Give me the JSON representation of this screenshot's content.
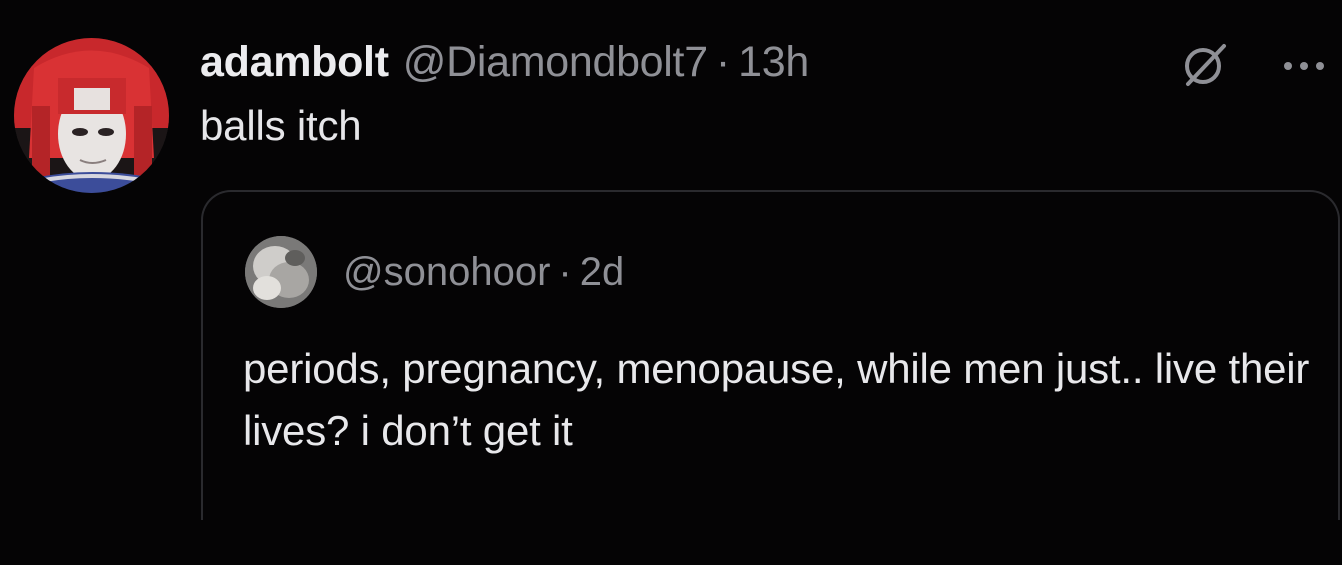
{
  "tweet": {
    "author": {
      "display_name": "adambolt",
      "handle": "@Diamondbolt7",
      "avatar_icon": "avatar-icon"
    },
    "separator": "·",
    "time": "13h",
    "text": "balls itch",
    "actions": {
      "grok_icon": "grok-icon",
      "more_icon": "more-icon"
    }
  },
  "quote": {
    "handle": "@sonohoor",
    "separator": "·",
    "time": "2d",
    "text": "periods, pregnancy, menopause, while men just.. live their lives? i don’t get it",
    "avatar_icon": "avatar-icon"
  },
  "colors": {
    "background": "#050405",
    "text_primary": "#e9e9ec",
    "text_secondary": "#8f9096",
    "border": "#2a2a2e"
  }
}
